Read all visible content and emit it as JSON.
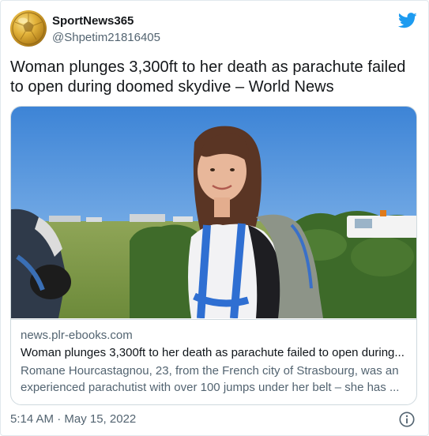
{
  "author": {
    "display_name": "SportNews365",
    "handle": "@Shpetim21816405",
    "avatar_icon": "gold-ball-avatar"
  },
  "tweet": {
    "text_line1": "Woman plunges 3,300ft to her death as parachute failed",
    "text_line2": "to open during doomed skydive – World News"
  },
  "card": {
    "image_icon": "skydiver-photo",
    "domain": "news.plr-ebooks.com",
    "title": "Woman plunges 3,300ft to her death as parachute failed to open during...",
    "description_line1": "Romane Hourcastagnou, 23, from the French city of Strasbourg, was an",
    "description_line2": "experienced parachutist with over 100 jumps under her belt – she has ..."
  },
  "footer": {
    "timestamp": "5:14 AM · May 15, 2022",
    "info_icon": "info-icon"
  },
  "colors": {
    "twitter_blue": "#1d9bf0",
    "secondary_text": "#536471",
    "border": "#cfd9de"
  }
}
